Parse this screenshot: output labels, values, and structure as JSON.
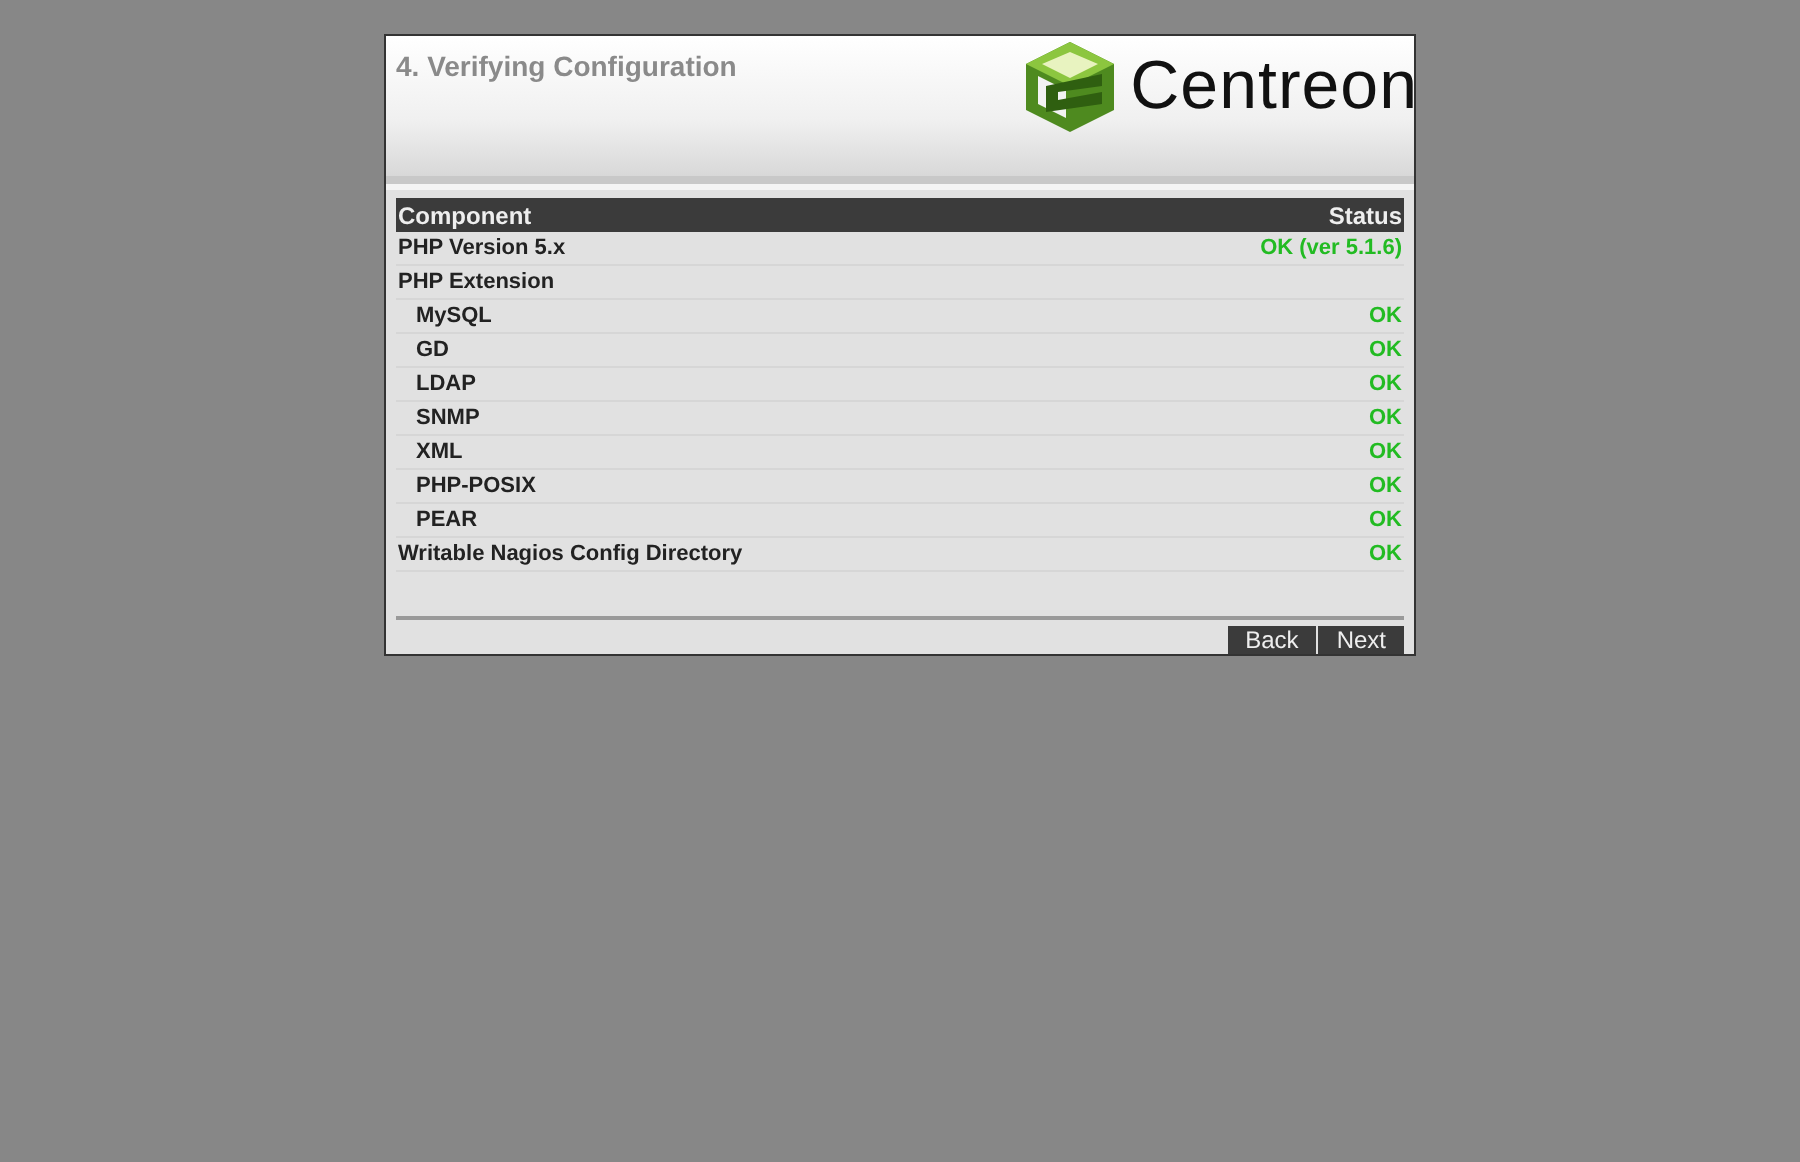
{
  "header": {
    "title": "4. Verifying Configuration",
    "logo_text": "Centreon"
  },
  "table": {
    "columns": [
      "Component",
      "Status"
    ],
    "rows": [
      {
        "component": "PHP Version 5.x",
        "status": "OK (ver 5.1.6)",
        "passed": true
      },
      {
        "component": "PHP Extension",
        "children": [
          {
            "component": "MySQL",
            "status": "OK",
            "passed": true
          },
          {
            "component": "GD",
            "status": "OK",
            "passed": true
          },
          {
            "component": "LDAP",
            "status": "OK",
            "passed": true
          },
          {
            "component": "SNMP",
            "status": "OK",
            "passed": true
          },
          {
            "component": "XML",
            "status": "OK",
            "passed": true
          },
          {
            "component": "PHP-POSIX",
            "status": "OK",
            "passed": true
          },
          {
            "component": "PEAR",
            "status": "OK",
            "passed": true
          }
        ]
      },
      {
        "component": "Writable Nagios Config Directory",
        "status": "OK",
        "passed": true
      }
    ]
  },
  "buttons": [
    "Back",
    "Next"
  ]
}
